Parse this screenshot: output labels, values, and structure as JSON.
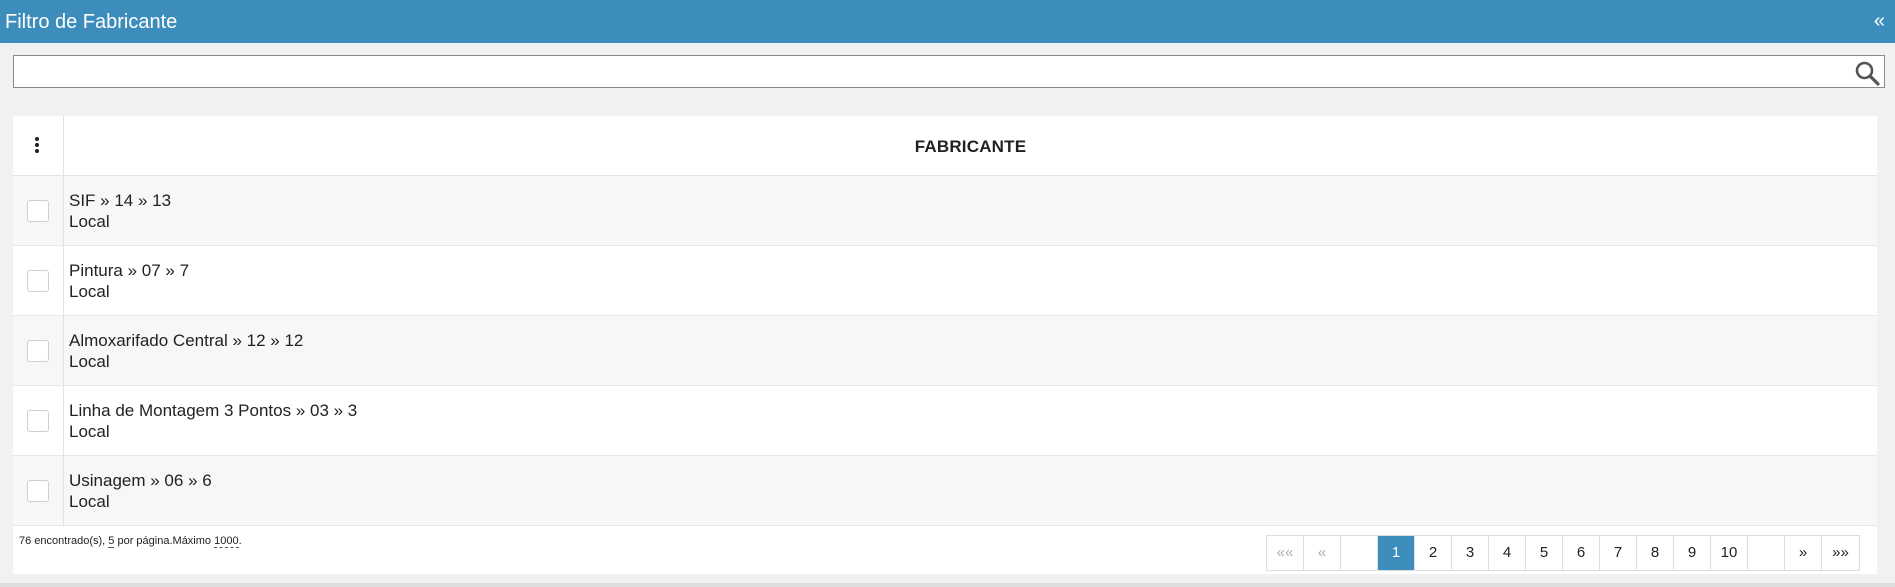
{
  "header": {
    "title": "Filtro de Fabricante",
    "collapse_label": "«"
  },
  "search": {
    "value": "",
    "placeholder": ""
  },
  "table": {
    "column_title": "FABRICANTE",
    "rows": [
      {
        "name": "SIF » 14 » 13",
        "sub": "Local"
      },
      {
        "name": "Pintura » 07 » 7",
        "sub": "Local"
      },
      {
        "name": "Almoxarifado Central » 12 » 12",
        "sub": "Local"
      },
      {
        "name": "Linha de Montagem 3 Pontos » 03 » 3",
        "sub": "Local"
      },
      {
        "name": "Usinagem » 06 » 6",
        "sub": "Local"
      }
    ]
  },
  "footer": {
    "count": "76",
    "found_label": " encontrado(s), ",
    "per_page": "5",
    "per_page_label": " por página.",
    "max_label": "Máximo ",
    "max_value": "1000",
    "end": "."
  },
  "pagination": {
    "first": "««",
    "prev": "«",
    "blank_before": "",
    "pages": [
      "1",
      "2",
      "3",
      "4",
      "5",
      "6",
      "7",
      "8",
      "9",
      "10"
    ],
    "active_page": "1",
    "blank_after": "",
    "next": "»",
    "last": "»»"
  },
  "colors": {
    "accent": "#3c8dbc"
  }
}
